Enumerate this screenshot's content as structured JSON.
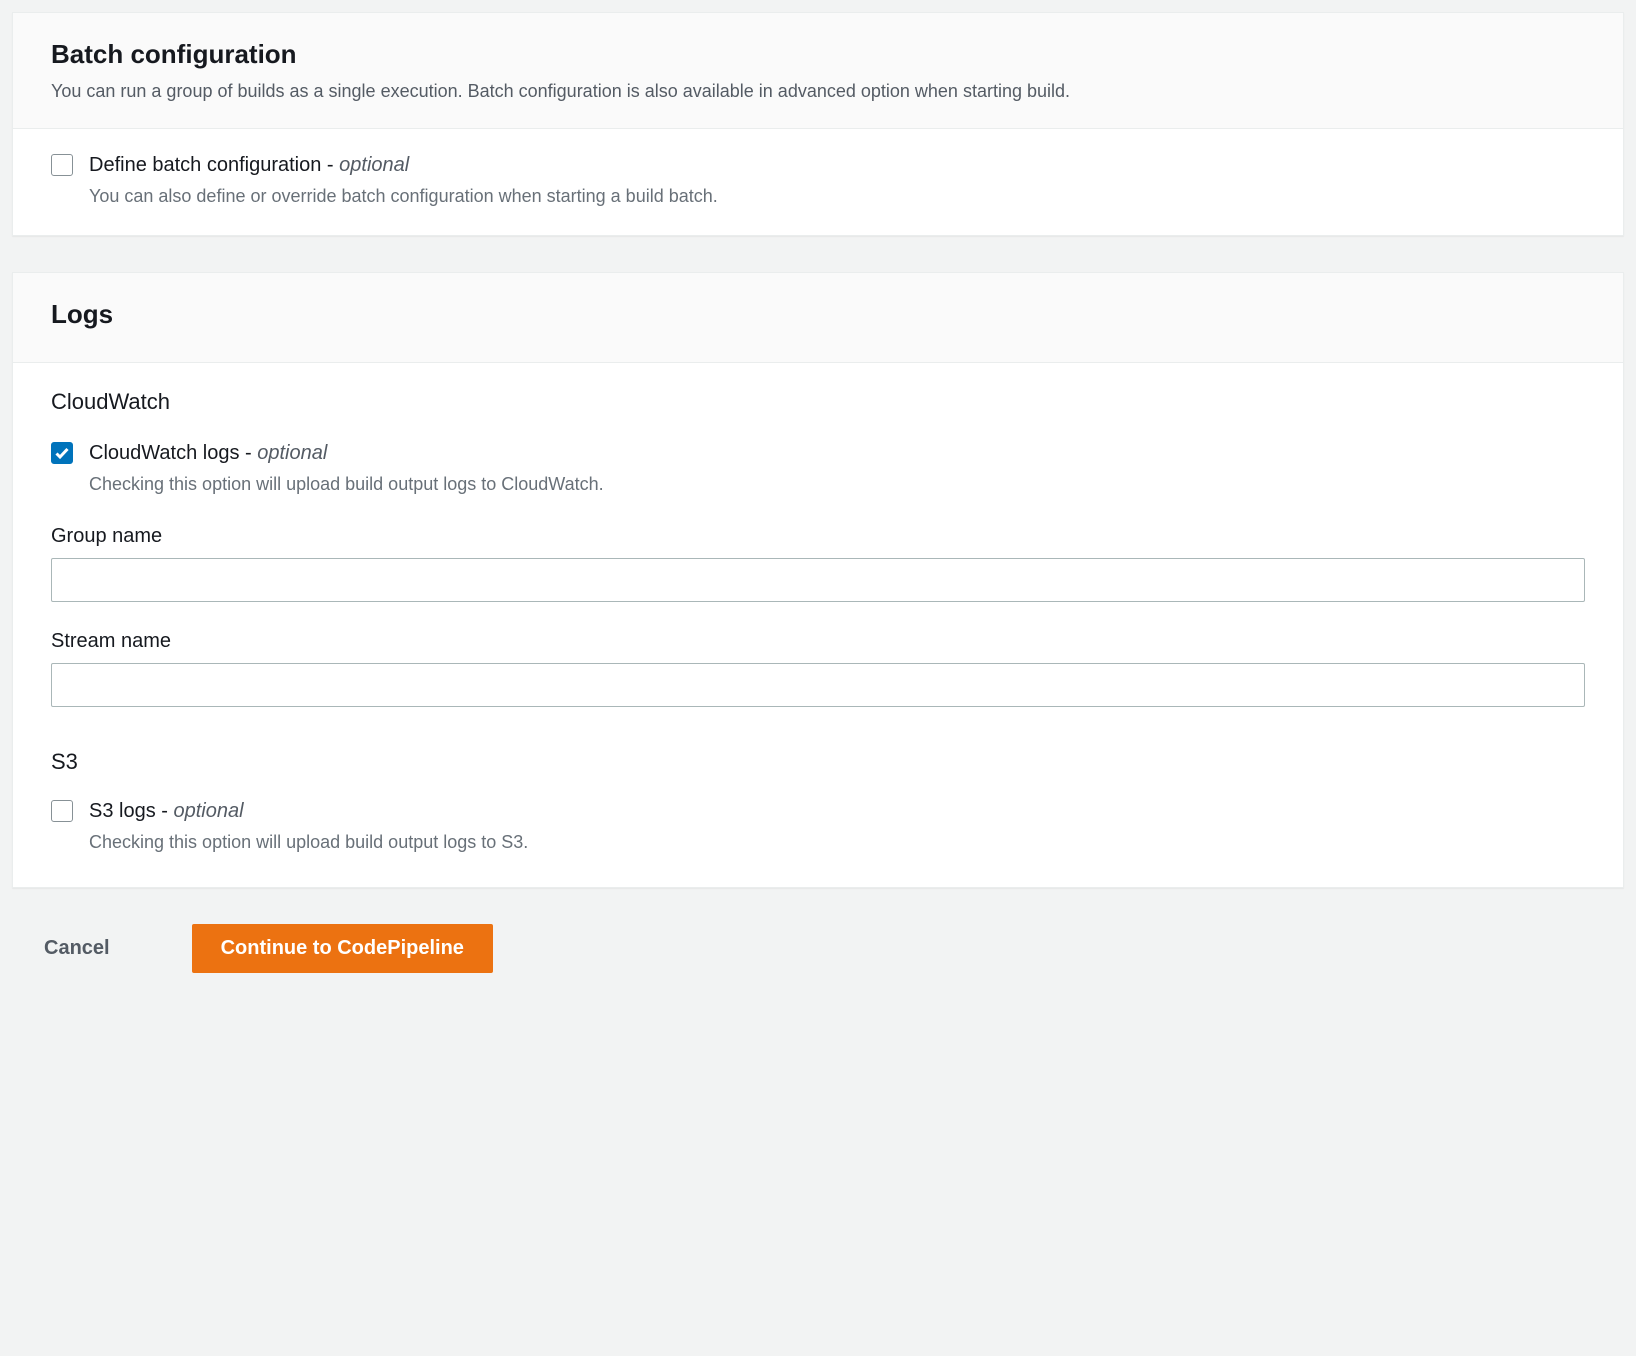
{
  "batch": {
    "title": "Batch configuration",
    "description": "You can run a group of builds as a single execution. Batch configuration is also available in advanced option when starting build.",
    "define": {
      "label": "Define batch configuration - ",
      "optional": "optional",
      "description": "You can also define or override batch configuration when starting a build batch.",
      "checked": false
    }
  },
  "logs": {
    "title": "Logs",
    "cloudwatch": {
      "heading": "CloudWatch",
      "label": "CloudWatch logs - ",
      "optional": "optional",
      "description": "Checking this option will upload build output logs to CloudWatch.",
      "checked": true,
      "group_name_label": "Group name",
      "group_name_value": "",
      "stream_name_label": "Stream name",
      "stream_name_value": ""
    },
    "s3": {
      "heading": "S3",
      "label": "S3 logs - ",
      "optional": "optional",
      "description": "Checking this option will upload build output logs to S3.",
      "checked": false
    }
  },
  "footer": {
    "cancel": "Cancel",
    "continue": "Continue to CodePipeline"
  }
}
